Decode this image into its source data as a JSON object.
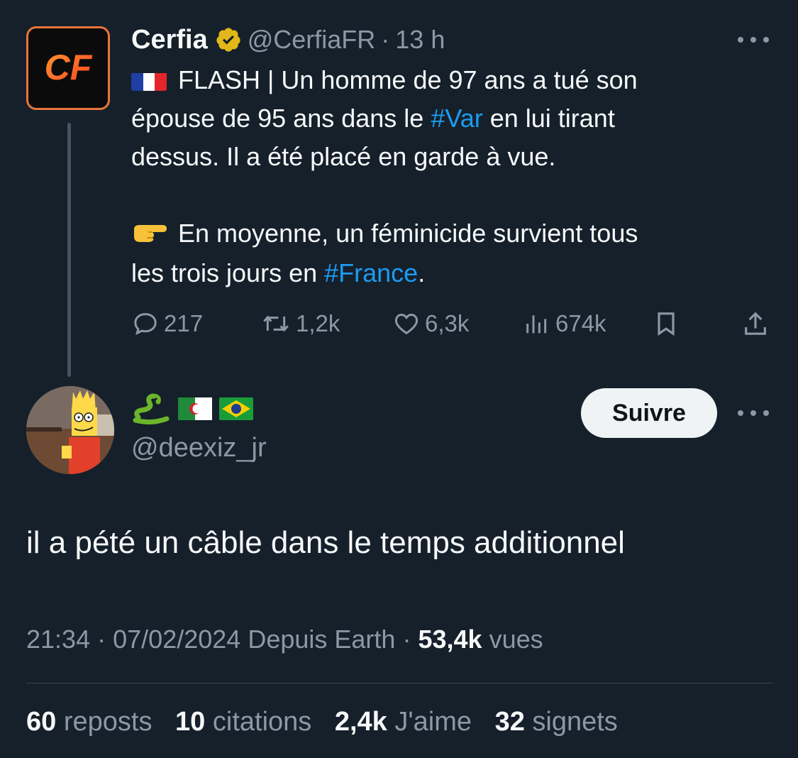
{
  "parent": {
    "author_name": "Cerfia",
    "handle": "@CerfiaFR",
    "separator": "·",
    "time": "13 h",
    "avatar_text": "CF",
    "text_line1": "FLASH | Un homme de 97 ans a tué son",
    "text_line2_pre": "épouse de 95 ans dans le ",
    "hashtag_var": "#Var",
    "text_line2_post": " en lui tirant",
    "text_line3": "dessus. Il a été placé en garde à vue.",
    "text_line4": "En moyenne, un féminicide survient tous",
    "text_line5_pre": "les trois jours en ",
    "hashtag_france": "#France",
    "text_line5_post": ".",
    "replies": "217",
    "reposts": "1,2k",
    "likes": "6,3k",
    "views": "674k"
  },
  "reply": {
    "display_name_emojis": [
      "snake-emoji",
      "algeria-flag",
      "brazil-flag"
    ],
    "handle": "@deexiz_jr",
    "follow_label": "Suivre",
    "text": "il a pété un câble dans le temps additionnel",
    "time": "21:34",
    "sep1": "·",
    "date": "07/02/2024",
    "source": "Depuis Earth",
    "sep2": "·",
    "views_count": "53,4k",
    "views_label": "vues",
    "reposts_count": "60",
    "reposts_label": "reposts",
    "quotes_count": "10",
    "quotes_label": "citations",
    "likes_count": "2,4k",
    "likes_label": "J'aime",
    "bookmarks_count": "32",
    "bookmarks_label": "signets"
  },
  "colors": {
    "background": "#15202b",
    "text": "#f7f9f9",
    "muted": "#8b98a5",
    "link": "#1d9bf0",
    "verified": "#e2b719",
    "cerfia_brand": "#ff5a1f"
  },
  "icons": [
    "verified-badge-icon",
    "more-icon",
    "reply-icon",
    "repost-icon",
    "like-icon",
    "views-icon",
    "bookmark-icon",
    "share-icon",
    "france-flag-icon",
    "pointing-finger-icon"
  ]
}
